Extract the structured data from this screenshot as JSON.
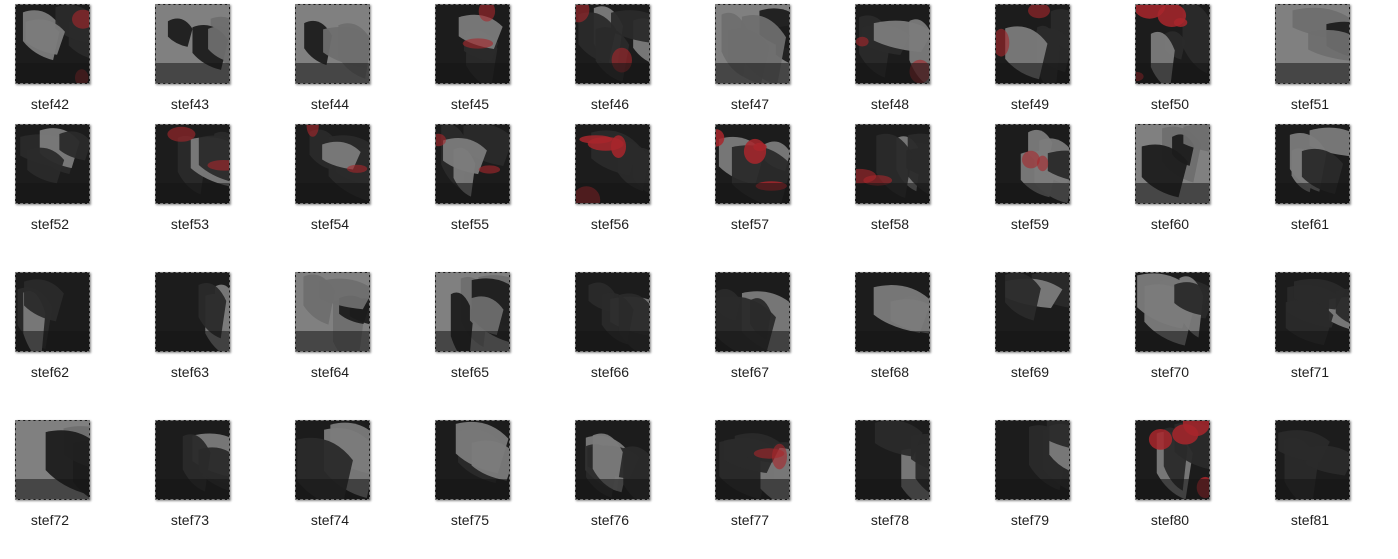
{
  "colors": {
    "background": "#ffffff",
    "thumb_dark": "#1c1c1c",
    "thumb_gray": "#7b7b7b",
    "thumb_red": "#a8262b",
    "label": "#1f1f1f"
  },
  "items": [
    {
      "name": "stef42",
      "tint": "red-gray"
    },
    {
      "name": "stef43",
      "tint": "gray"
    },
    {
      "name": "stef44",
      "tint": "gray"
    },
    {
      "name": "stef45",
      "tint": "red-gray"
    },
    {
      "name": "stef46",
      "tint": "red-gray"
    },
    {
      "name": "stef47",
      "tint": "gray"
    },
    {
      "name": "stef48",
      "tint": "red-dark"
    },
    {
      "name": "stef49",
      "tint": "red-gray"
    },
    {
      "name": "stef50",
      "tint": "red"
    },
    {
      "name": "stef51",
      "tint": "gray"
    },
    {
      "name": "stef52",
      "tint": "dark"
    },
    {
      "name": "stef53",
      "tint": "red-dark"
    },
    {
      "name": "stef54",
      "tint": "red-dark"
    },
    {
      "name": "stef55",
      "tint": "red-gray"
    },
    {
      "name": "stef56",
      "tint": "red"
    },
    {
      "name": "stef57",
      "tint": "red"
    },
    {
      "name": "stef58",
      "tint": "red-dark"
    },
    {
      "name": "stef59",
      "tint": "red-gray"
    },
    {
      "name": "stef60",
      "tint": "gray"
    },
    {
      "name": "stef61",
      "tint": "dark"
    },
    {
      "name": "stef62",
      "tint": "dark"
    },
    {
      "name": "stef63",
      "tint": "dark"
    },
    {
      "name": "stef64",
      "tint": "gray"
    },
    {
      "name": "stef65",
      "tint": "gray"
    },
    {
      "name": "stef66",
      "tint": "dark"
    },
    {
      "name": "stef67",
      "tint": "dark"
    },
    {
      "name": "stef68",
      "tint": "dark"
    },
    {
      "name": "stef69",
      "tint": "dark"
    },
    {
      "name": "stef70",
      "tint": "dark"
    },
    {
      "name": "stef71",
      "tint": "dark"
    },
    {
      "name": "stef72",
      "tint": "gray"
    },
    {
      "name": "stef73",
      "tint": "dark"
    },
    {
      "name": "stef74",
      "tint": "dark"
    },
    {
      "name": "stef75",
      "tint": "dark"
    },
    {
      "name": "stef76",
      "tint": "dark"
    },
    {
      "name": "stef77",
      "tint": "red-dark"
    },
    {
      "name": "stef78",
      "tint": "dark"
    },
    {
      "name": "stef79",
      "tint": "dark"
    },
    {
      "name": "stef80",
      "tint": "red"
    },
    {
      "name": "stef81",
      "tint": "dark"
    }
  ]
}
